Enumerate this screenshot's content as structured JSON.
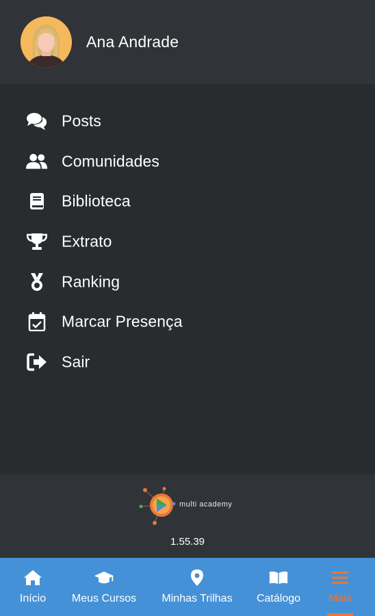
{
  "user": {
    "name": "Ana Andrade"
  },
  "menu": {
    "items": [
      {
        "label": "Posts",
        "icon": "comments-icon"
      },
      {
        "label": "Comunidades",
        "icon": "users-icon"
      },
      {
        "label": "Biblioteca",
        "icon": "book-icon"
      },
      {
        "label": "Extrato",
        "icon": "trophy-icon"
      },
      {
        "label": "Ranking",
        "icon": "medal-icon"
      },
      {
        "label": "Marcar Presença",
        "icon": "calendar-check-icon"
      },
      {
        "label": "Sair",
        "icon": "sign-out-icon"
      }
    ]
  },
  "footer": {
    "logo_text": "multi academy",
    "version": "1.55.39"
  },
  "bottom_nav": {
    "items": [
      {
        "label": "Início",
        "icon": "home-icon"
      },
      {
        "label": "Meus Cursos",
        "icon": "graduation-cap-icon"
      },
      {
        "label": "Minhas Trilhas",
        "icon": "map-marker-icon"
      },
      {
        "label": "Catálogo",
        "icon": "open-book-icon"
      },
      {
        "label": "Mais",
        "icon": "hamburger-menu-icon",
        "active": true
      }
    ]
  },
  "colors": {
    "header_bg": "#303438",
    "body_bg": "#292c2f",
    "nav_bg": "#4591d8",
    "accent": "#e97737",
    "avatar_bg": "#f6b85c"
  }
}
